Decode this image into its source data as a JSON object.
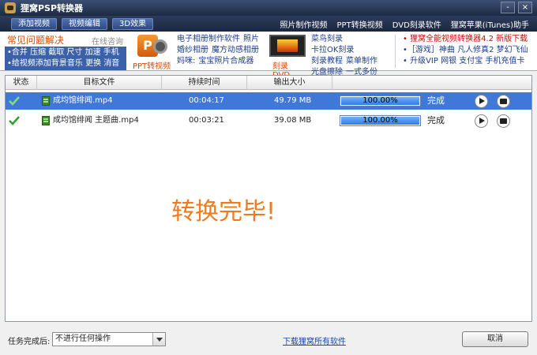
{
  "window": {
    "title": "狸窝PSP转换器",
    "controls": [
      "-",
      "×"
    ]
  },
  "toolbar": {
    "add_video": "添加视频",
    "edit_video": "视频编辑",
    "effect_3d": "3D效果",
    "links": [
      "照片制作视频",
      "PPT转换视频",
      "DVD刻录软件",
      "狸窝苹果(iTunes)助手"
    ]
  },
  "promo": {
    "faq_title": "常见问题解决",
    "faq_online": "在线咨询",
    "faq_line1": "•合并 压缩 截取 尺寸 加速 手机",
    "faq_line2": "•给视频添加背景音乐 更换 消音",
    "ppt_caption": "PPT转视频",
    "ppt_badge": "P",
    "col1": [
      "电子相册制作软件",
      "照片",
      "婚纱相册",
      "魔方动感相册",
      "妈咪:",
      "宝宝照片合成器"
    ],
    "dvd_caption": "刻录DVD",
    "col2": [
      "菜鸟刻录",
      "卡拉OK刻录",
      "刻录教程",
      "菜单制作",
      "光盘擦除",
      "一式多份"
    ],
    "col3_line1": "• 狸窝全能视频转换器4.2 新版下载",
    "col3_line2": "•［游戏］神曲  凡人修真2 梦幻飞仙",
    "col3_line3": "• 升级VIP 网银 支付宝 手机充值卡"
  },
  "table": {
    "headers": [
      "状态",
      "目标文件",
      "持续时间",
      "输出大小"
    ],
    "rows": [
      {
        "file": "成均馆绯闻.mp4",
        "duration": "00:04:17",
        "size": "49.79 MB",
        "progress": "100.00%",
        "progress_fraction": 1.0,
        "status": "完成"
      },
      {
        "file": "成均馆绯闻 主题曲.mp4",
        "duration": "00:03:21",
        "size": "39.08 MB",
        "progress": "100.00%",
        "progress_fraction": 1.0,
        "status": "完成"
      }
    ],
    "done_message": "转换完毕!"
  },
  "bottom": {
    "after_label": "任务完成后:",
    "after_option": "不进行任何操作",
    "download_link": "下载狸窝所有软件",
    "cancel": "取消"
  },
  "colors": {
    "selected_row": "#3f78d8",
    "done_message": "#f37a1a",
    "accent_orange": "#e04a00"
  }
}
